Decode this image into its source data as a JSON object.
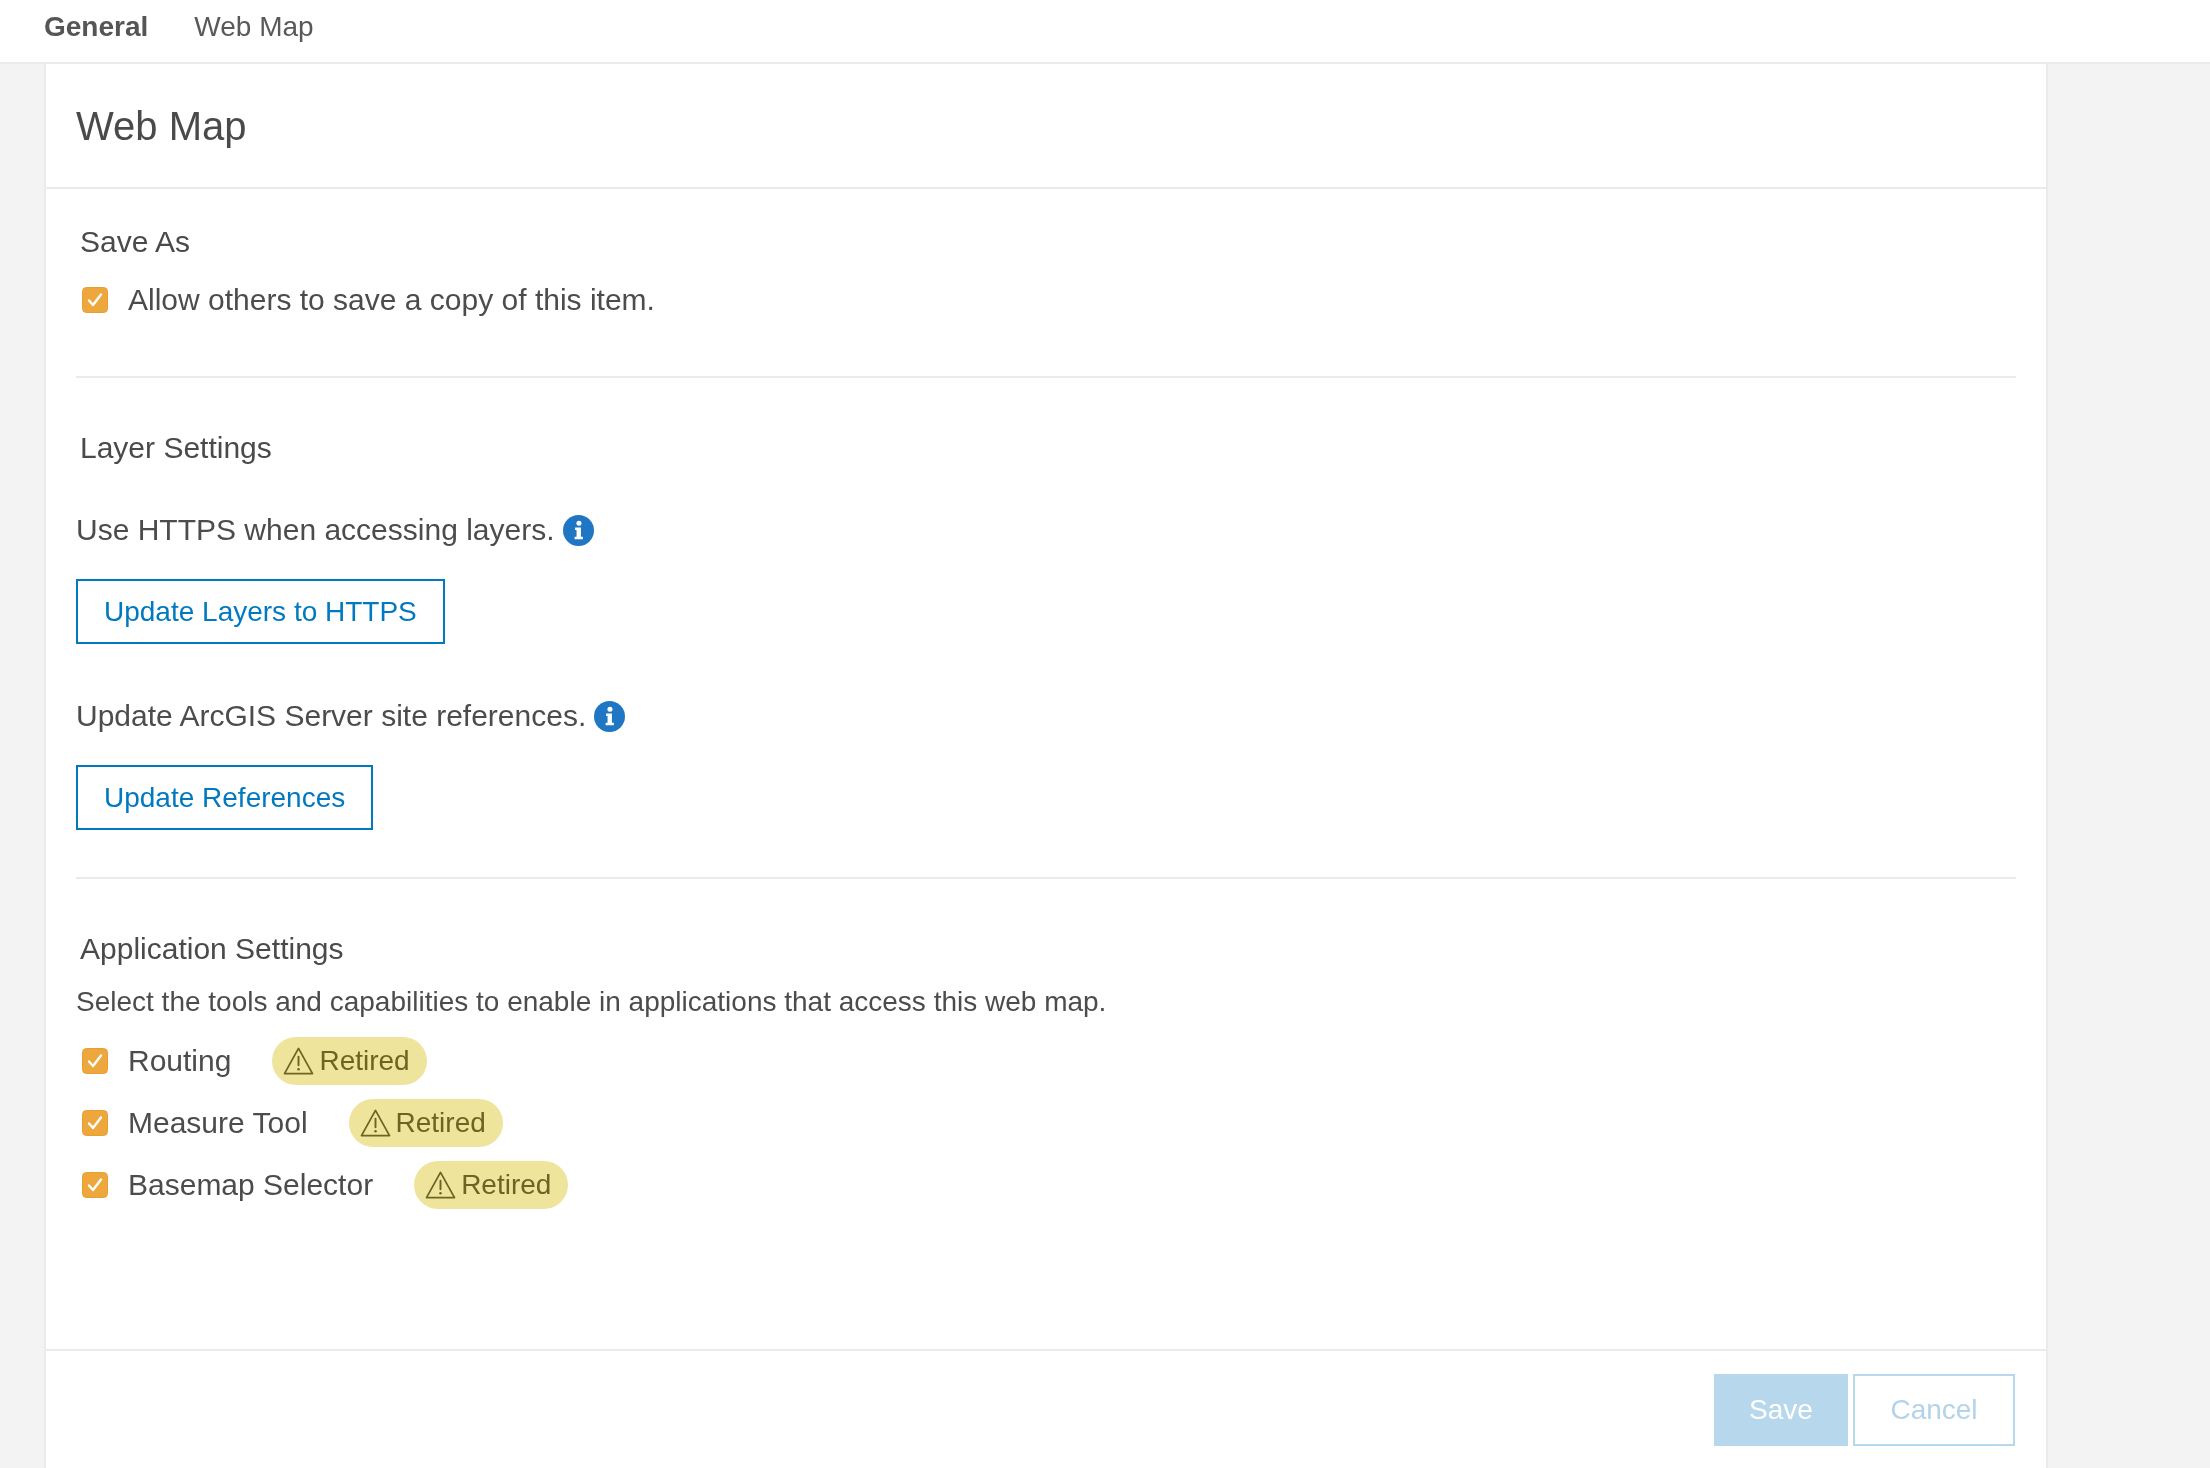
{
  "tabs": [
    {
      "label": "General",
      "selected": true
    },
    {
      "label": "Web Map",
      "selected": false
    }
  ],
  "panel": {
    "title": "Web Map"
  },
  "save_as": {
    "heading": "Save As",
    "option": {
      "label": "Allow others to save a copy of this item.",
      "checked": true
    }
  },
  "layer_settings": {
    "heading": "Layer Settings",
    "actions": [
      {
        "text": "Use HTTPS when accessing layers.",
        "button": "Update Layers to HTTPS"
      },
      {
        "text": "Update ArcGIS Server site references.",
        "button": "Update References"
      }
    ]
  },
  "application_settings": {
    "heading": "Application Settings",
    "description": "Select the tools and capabilities to enable in applications that access this web map.",
    "tools": [
      {
        "label": "Routing",
        "checked": true,
        "badge": "Retired"
      },
      {
        "label": "Measure Tool",
        "checked": true,
        "badge": "Retired"
      },
      {
        "label": "Basemap Selector",
        "checked": true,
        "badge": "Retired"
      }
    ]
  },
  "footer": {
    "buttons": [
      {
        "label": "Save",
        "kind": "primary",
        "disabled": true
      },
      {
        "label": "Cancel",
        "kind": "secondary",
        "disabled": true
      }
    ]
  }
}
